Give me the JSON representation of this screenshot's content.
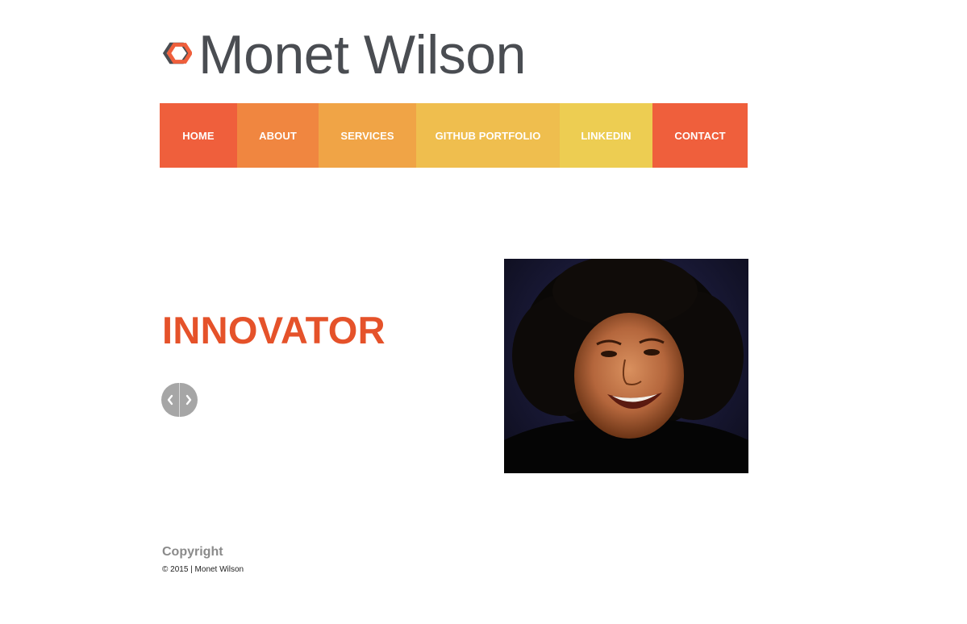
{
  "site": {
    "title": "Monet Wilson",
    "logo_icon": "hexagon-logo-icon"
  },
  "nav": {
    "items": [
      {
        "label": "HOME",
        "color": "#ef5f3c"
      },
      {
        "label": "ABOUT",
        "color": "#f08640"
      },
      {
        "label": "SERVICES",
        "color": "#f0a446"
      },
      {
        "label": "GITHUB PORTFOLIO",
        "color": "#efbe4e"
      },
      {
        "label": "LINKEDIN",
        "color": "#edcd52"
      },
      {
        "label": "CONTACT",
        "color": "#ef5f3c"
      }
    ]
  },
  "hero": {
    "headline": "INNOVATOR",
    "headline_color": "#e5522a",
    "prev_icon": "chevron-left-icon",
    "next_icon": "chevron-right-icon"
  },
  "footer": {
    "heading": "Copyright",
    "text": "© 2015 | Monet Wilson"
  }
}
